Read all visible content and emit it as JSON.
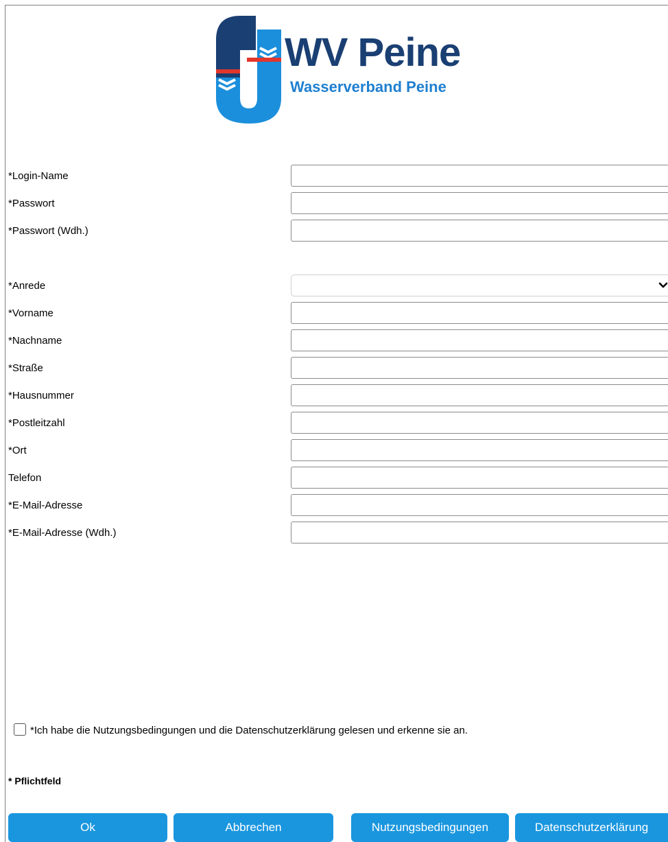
{
  "brand": {
    "name": "WV Peine",
    "subtitle": "Wasserverband Peine",
    "colors": {
      "dark_blue": "#1a3f73",
      "light_blue": "#1f7fd0",
      "red": "#e2362c"
    }
  },
  "form": {
    "fields": [
      {
        "label": "*Login-Name",
        "value": "",
        "type": "text"
      },
      {
        "label": "*Passwort",
        "value": "",
        "type": "password"
      },
      {
        "label": "*Passwort (Wdh.)",
        "value": "",
        "type": "password"
      },
      {
        "label": "*Anrede",
        "value": "",
        "type": "select"
      },
      {
        "label": "*Vorname",
        "value": "",
        "type": "text"
      },
      {
        "label": "*Nachname",
        "value": "",
        "type": "text"
      },
      {
        "label": "*Straße",
        "value": "",
        "type": "text"
      },
      {
        "label": "*Hausnummer",
        "value": "",
        "type": "text"
      },
      {
        "label": "*Postleitzahl",
        "value": "",
        "type": "text"
      },
      {
        "label": "*Ort",
        "value": "",
        "type": "text"
      },
      {
        "label": "Telefon",
        "value": "",
        "type": "text"
      },
      {
        "label": "*E-Mail-Adresse",
        "value": "",
        "type": "text"
      },
      {
        "label": "*E-Mail-Adresse (Wdh.)",
        "value": "",
        "type": "text"
      }
    ],
    "consent_text": "*Ich habe die Nutzungsbedingungen und die Datenschutzerklärung gelesen und erkenne sie an.",
    "consent_checked": false,
    "required_note": "* Pflichtfeld"
  },
  "buttons": {
    "ok": "Ok",
    "cancel": "Abbrechen",
    "terms": "Nutzungsbedingungen",
    "privacy": "Datenschutzerklärung",
    "color": "#1a96df"
  },
  "icons": {
    "logo": "wv-peine-logo",
    "select_arrow": "chevron-down-icon"
  }
}
